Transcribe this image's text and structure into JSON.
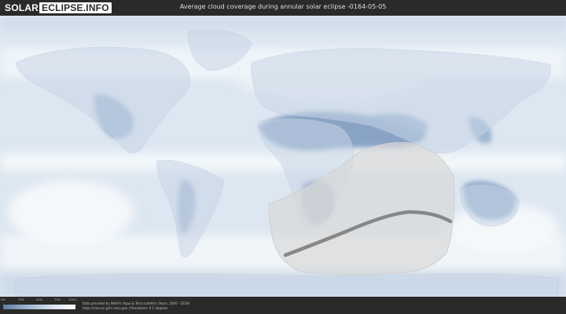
{
  "header": {
    "logo_part1": "SOLAR",
    "logo_part2": "ECLIPSE.INFO",
    "title": "Average cloud coverage during annular solar eclipse -0164-05-05"
  },
  "legend": {
    "ticks": [
      "0%",
      "25%",
      "50%",
      "75%",
      "100%"
    ]
  },
  "footer": {
    "credit_line1": "Data provided by NASA's Aqua & Terra satellite (Years: 2000 - 2019)",
    "credit_line2": "https://neo.sci.gsfc.nasa.gov | Resolution: 0.1 degrees"
  },
  "colors": {
    "clear_sky": "#5c7ea8",
    "overcast": "#ffffff",
    "visibility_zone": "#d9d9d9",
    "central_path": "#777777"
  }
}
